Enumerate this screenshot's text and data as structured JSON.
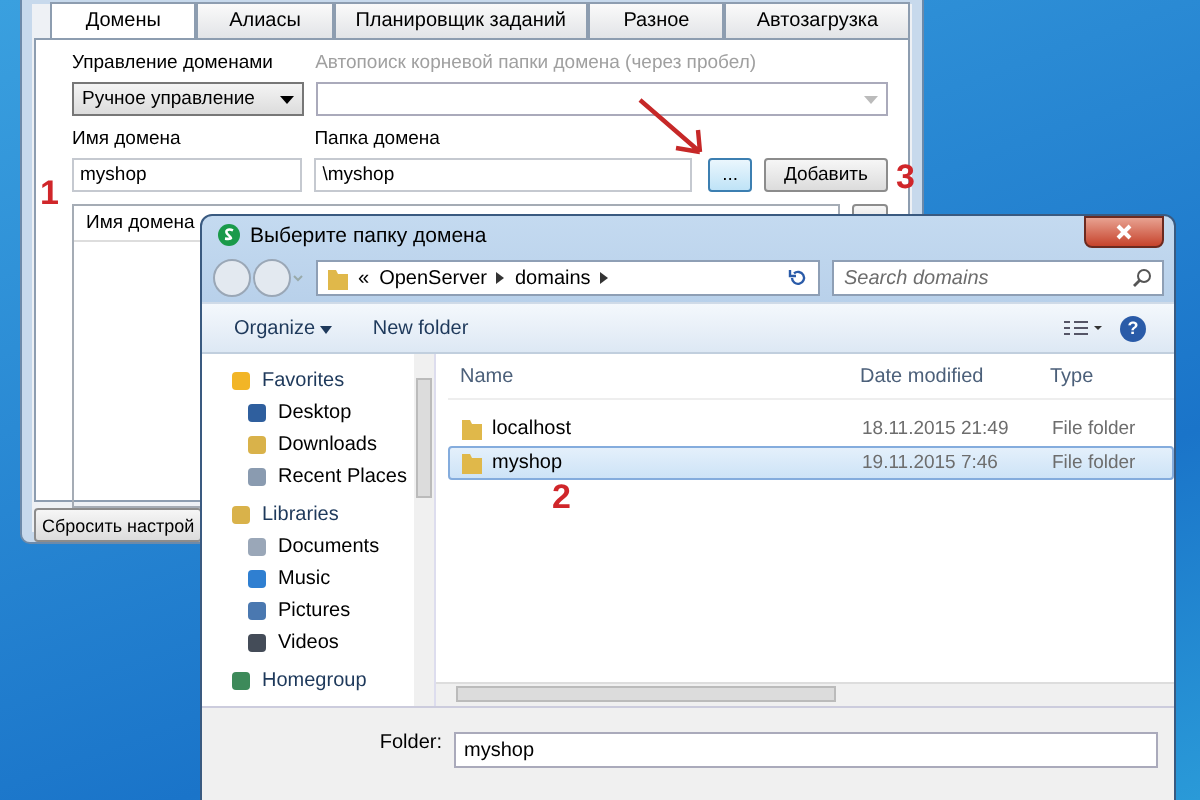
{
  "back_window": {
    "tabs": [
      {
        "label": "Домены",
        "selected": true
      },
      {
        "label": "Алиасы",
        "selected": false
      },
      {
        "label": "Планировщик заданий",
        "selected": false
      },
      {
        "label": "Разное",
        "selected": false
      },
      {
        "label": "Автозагрузка",
        "selected": false
      }
    ],
    "mode_label": "Управление доменами",
    "mode_value": "Ручное управление",
    "autosearch_label": "Автопоиск корневой папки домена (через пробел)",
    "autosearch_disabled": true,
    "name_label": "Имя домена",
    "name_value": "myshop",
    "folder_label": "Папка домена",
    "folder_value": "\\myshop",
    "browse_button": "...",
    "add_button": "Добавить",
    "list_column": "Имя домена",
    "reset_button": "Сбросить настрой"
  },
  "markers": [
    {
      "label": "1"
    },
    {
      "label": "2"
    },
    {
      "label": "3"
    }
  ],
  "dialog": {
    "title": "Выберите папку домена",
    "breadcrumb": [
      "«",
      "OpenServer",
      "domains"
    ],
    "search_placeholder": "Search domains",
    "toolbar": [
      "Organize",
      "New folder"
    ],
    "help_button": "?",
    "nav": [
      {
        "label": "Favorites",
        "kind": "group"
      },
      {
        "label": "Desktop",
        "kind": "item"
      },
      {
        "label": "Downloads",
        "kind": "item"
      },
      {
        "label": "Recent Places",
        "kind": "item"
      },
      {
        "label": "Libraries",
        "kind": "group"
      },
      {
        "label": "Documents",
        "kind": "item"
      },
      {
        "label": "Music",
        "kind": "item"
      },
      {
        "label": "Pictures",
        "kind": "item"
      },
      {
        "label": "Videos",
        "kind": "item"
      },
      {
        "label": "Homegroup",
        "kind": "group"
      }
    ],
    "columns": [
      "Name",
      "Date modified",
      "Type"
    ],
    "rows": [
      {
        "name": "localhost",
        "date": "18.11.2015 21:49",
        "type": "File folder",
        "selected": false
      },
      {
        "name": "myshop",
        "date": "19.11.2015 7:46",
        "type": "File folder",
        "selected": true
      }
    ],
    "folder_label": "Folder:",
    "folder_value": "myshop"
  }
}
